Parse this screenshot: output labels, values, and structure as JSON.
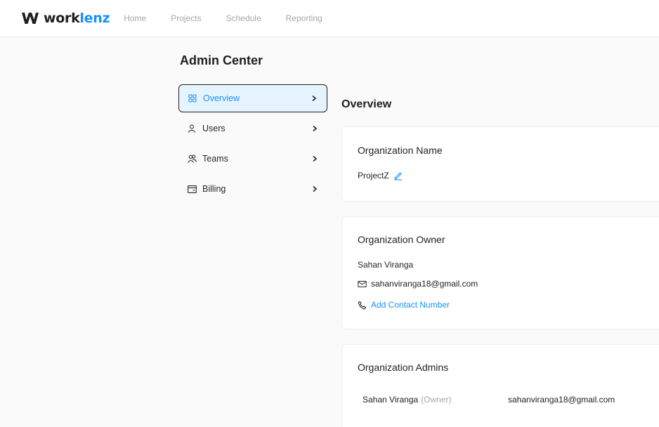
{
  "brand": {
    "name_part1": "work",
    "name_part2": "lenz",
    "accent": "#1890ff"
  },
  "nav": {
    "items": [
      {
        "label": "Home"
      },
      {
        "label": "Projects"
      },
      {
        "label": "Schedule"
      },
      {
        "label": "Reporting"
      }
    ]
  },
  "page": {
    "title": "Admin Center"
  },
  "menu": {
    "items": [
      {
        "label": "Overview",
        "icon": "grid-icon",
        "active": true
      },
      {
        "label": "Users",
        "icon": "user-icon",
        "active": false
      },
      {
        "label": "Teams",
        "icon": "team-icon",
        "active": false
      },
      {
        "label": "Billing",
        "icon": "card-icon",
        "active": false
      }
    ]
  },
  "content": {
    "title": "Overview",
    "org_name": {
      "heading": "Organization Name",
      "value": "ProjectZ"
    },
    "org_owner": {
      "heading": "Organization Owner",
      "name": "Sahan Viranga",
      "email": "sahanviranga18@gmail.com",
      "add_contact": "Add Contact Number"
    },
    "org_admins": {
      "heading": "Organization Admins",
      "rows": [
        {
          "name": "Sahan Viranga",
          "role": "(Owner)",
          "email": "sahanviranga18@gmail.com"
        }
      ]
    }
  }
}
